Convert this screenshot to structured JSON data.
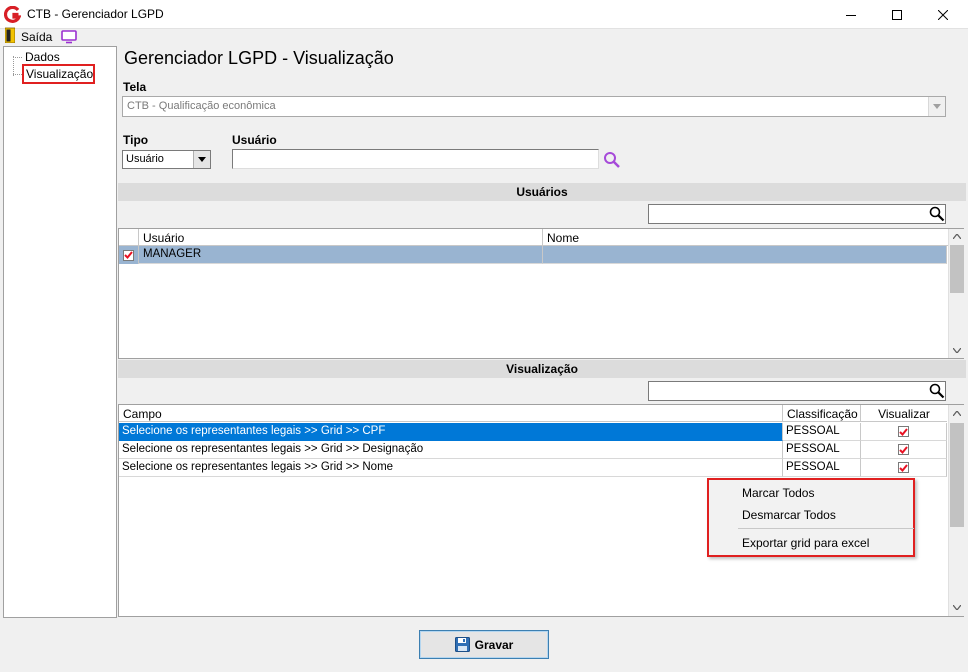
{
  "window": {
    "title": "CTB - Gerenciador LGPD",
    "app_icon": "ctb-logo-icon"
  },
  "menubar": {
    "exit_label": "Saída",
    "exit_icon": "door-exit-icon",
    "monitor_icon": "monitor-icon"
  },
  "tree": {
    "items": [
      {
        "label": "Dados",
        "selected": false
      },
      {
        "label": "Visualização",
        "selected": true
      }
    ]
  },
  "page": {
    "title": "Gerenciador LGPD - Visualização"
  },
  "form": {
    "tela_label": "Tela",
    "tela_value": "CTB - Qualificação econômica",
    "tipo_label": "Tipo",
    "tipo_value": "Usuário",
    "usuario_label": "Usuário",
    "usuario_value": ""
  },
  "usuarios_section": {
    "header": "Usuários",
    "filter_value": "",
    "columns": [
      "Usuário",
      "Nome"
    ],
    "rows": [
      {
        "checked": true,
        "usuario": "MANAGER",
        "nome": ""
      }
    ]
  },
  "visualizacao_section": {
    "header": "Visualização",
    "filter_value": "",
    "columns": [
      "Campo",
      "Classificação",
      "Visualizar"
    ],
    "rows": [
      {
        "campo": "Selecione os representantes legais >> Grid >> CPF",
        "classificacao": "PESSOAL",
        "visualizar": true,
        "selected": true
      },
      {
        "campo": "Selecione os representantes legais >> Grid >> Designação",
        "classificacao": "PESSOAL",
        "visualizar": true,
        "selected": false
      },
      {
        "campo": "Selecione os representantes legais >> Grid >> Nome",
        "classificacao": "PESSOAL",
        "visualizar": true,
        "selected": false
      }
    ]
  },
  "context_menu": {
    "items": [
      "Marcar Todos",
      "Desmarcar Todos",
      "Exportar grid para excel"
    ]
  },
  "footer": {
    "save_label": "Gravar",
    "save_icon": "floppy-disk-icon"
  },
  "colors": {
    "selection_blue": "#0078d7",
    "row_highlight": "#99b4d1",
    "annotation_red": "#e02020",
    "check_red": "#e81123"
  }
}
